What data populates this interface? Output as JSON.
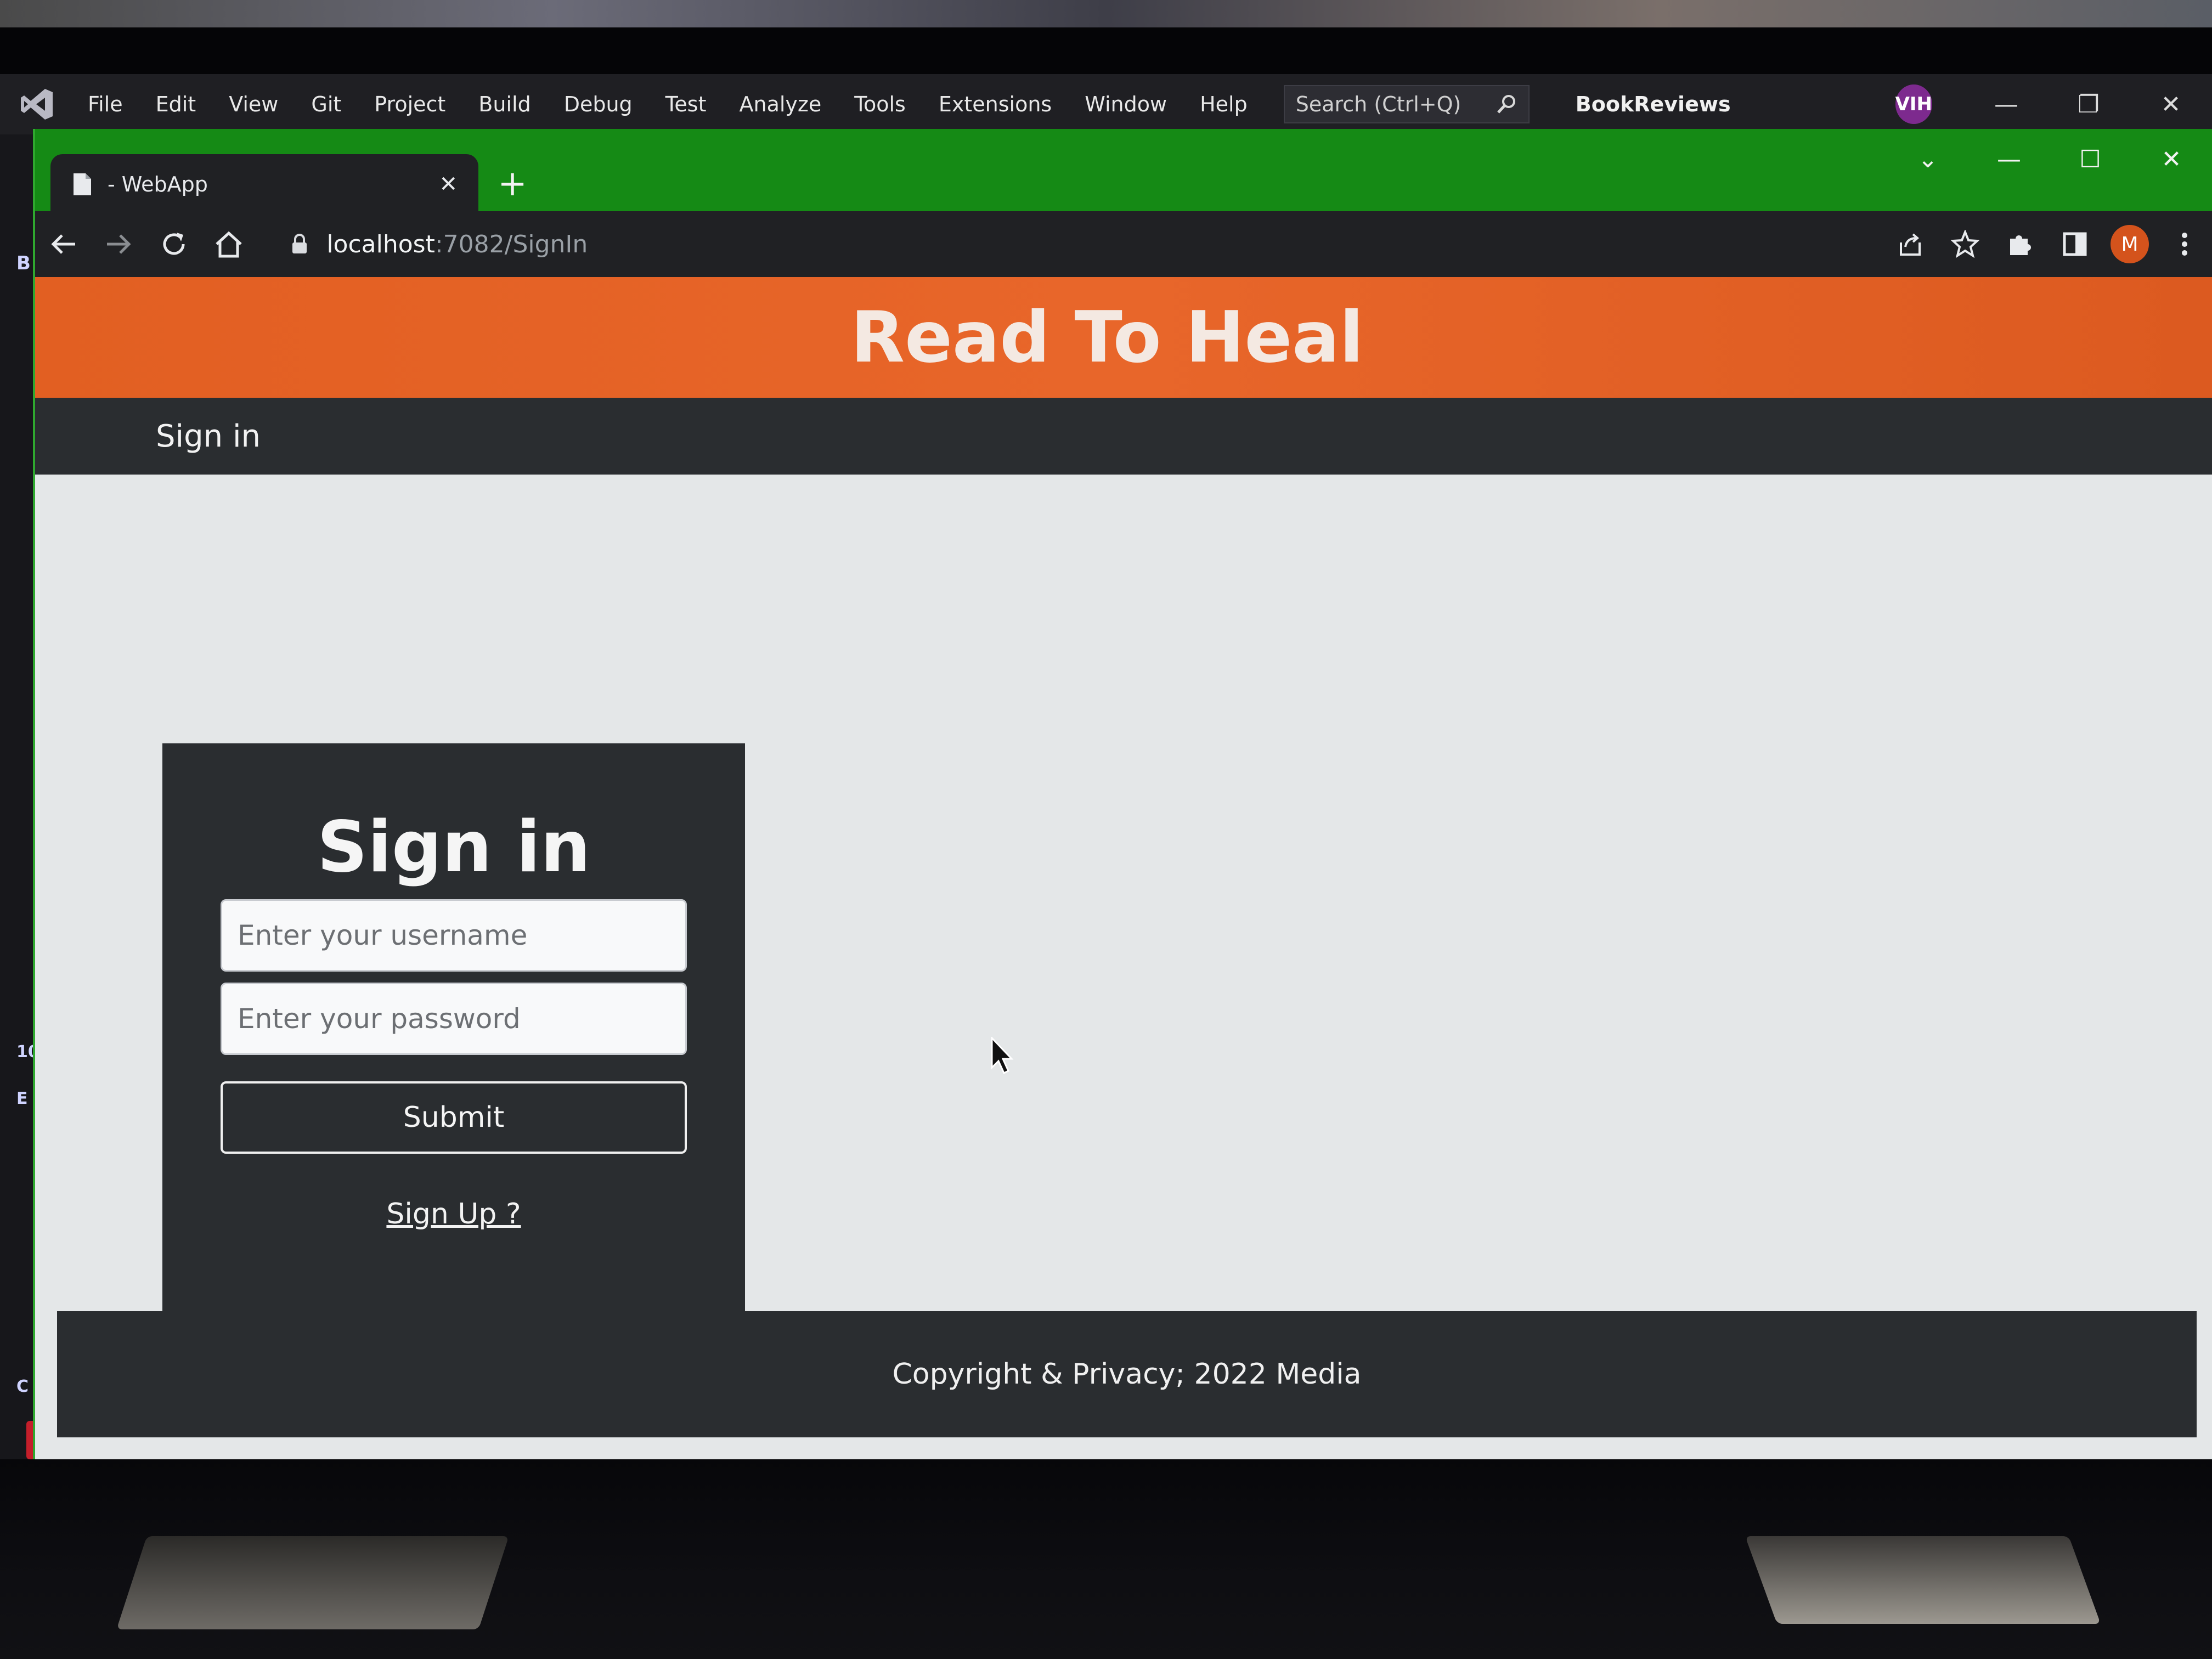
{
  "vs": {
    "menu": [
      "File",
      "Edit",
      "View",
      "Git",
      "Project",
      "Build",
      "Debug",
      "Test",
      "Analyze",
      "Tools",
      "Extensions",
      "Window",
      "Help"
    ],
    "search_placeholder": "Search (Ctrl+Q)",
    "solution_name": "BookReviews",
    "user_initials": "VIH",
    "side_marks": [
      "B",
      "10",
      "E",
      "C"
    ]
  },
  "browser": {
    "tab_title": "- WebApp",
    "url_host": "localhost",
    "url_path": ":7082/SignIn",
    "profile_initial": "M"
  },
  "site": {
    "title": "Read To Heal",
    "nav_signin": "Sign in",
    "card_heading": "Sign in",
    "username_placeholder": "Enter your username",
    "password_placeholder": "Enter your password",
    "submit_label": "Submit",
    "signup_label": "Sign Up ?",
    "footer_text": "Copyright & Privacy; 2022 Media"
  },
  "colors": {
    "header_orange": "#e8662a",
    "tabstrip_green": "#158a15",
    "dark_panel": "#2a2d30"
  }
}
